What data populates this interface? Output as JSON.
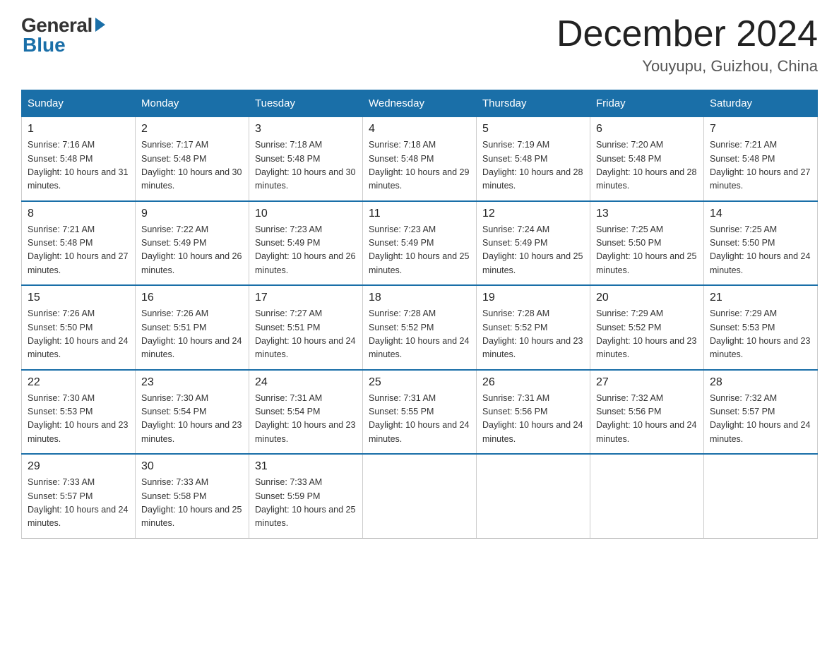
{
  "logo": {
    "general": "General",
    "blue": "Blue"
  },
  "title": "December 2024",
  "subtitle": "Youyupu, Guizhou, China",
  "days_of_week": [
    "Sunday",
    "Monday",
    "Tuesday",
    "Wednesday",
    "Thursday",
    "Friday",
    "Saturday"
  ],
  "weeks": [
    [
      {
        "day": "1",
        "sunrise": "7:16 AM",
        "sunset": "5:48 PM",
        "daylight": "10 hours and 31 minutes."
      },
      {
        "day": "2",
        "sunrise": "7:17 AM",
        "sunset": "5:48 PM",
        "daylight": "10 hours and 30 minutes."
      },
      {
        "day": "3",
        "sunrise": "7:18 AM",
        "sunset": "5:48 PM",
        "daylight": "10 hours and 30 minutes."
      },
      {
        "day": "4",
        "sunrise": "7:18 AM",
        "sunset": "5:48 PM",
        "daylight": "10 hours and 29 minutes."
      },
      {
        "day": "5",
        "sunrise": "7:19 AM",
        "sunset": "5:48 PM",
        "daylight": "10 hours and 28 minutes."
      },
      {
        "day": "6",
        "sunrise": "7:20 AM",
        "sunset": "5:48 PM",
        "daylight": "10 hours and 28 minutes."
      },
      {
        "day": "7",
        "sunrise": "7:21 AM",
        "sunset": "5:48 PM",
        "daylight": "10 hours and 27 minutes."
      }
    ],
    [
      {
        "day": "8",
        "sunrise": "7:21 AM",
        "sunset": "5:48 PM",
        "daylight": "10 hours and 27 minutes."
      },
      {
        "day": "9",
        "sunrise": "7:22 AM",
        "sunset": "5:49 PM",
        "daylight": "10 hours and 26 minutes."
      },
      {
        "day": "10",
        "sunrise": "7:23 AM",
        "sunset": "5:49 PM",
        "daylight": "10 hours and 26 minutes."
      },
      {
        "day": "11",
        "sunrise": "7:23 AM",
        "sunset": "5:49 PM",
        "daylight": "10 hours and 25 minutes."
      },
      {
        "day": "12",
        "sunrise": "7:24 AM",
        "sunset": "5:49 PM",
        "daylight": "10 hours and 25 minutes."
      },
      {
        "day": "13",
        "sunrise": "7:25 AM",
        "sunset": "5:50 PM",
        "daylight": "10 hours and 25 minutes."
      },
      {
        "day": "14",
        "sunrise": "7:25 AM",
        "sunset": "5:50 PM",
        "daylight": "10 hours and 24 minutes."
      }
    ],
    [
      {
        "day": "15",
        "sunrise": "7:26 AM",
        "sunset": "5:50 PM",
        "daylight": "10 hours and 24 minutes."
      },
      {
        "day": "16",
        "sunrise": "7:26 AM",
        "sunset": "5:51 PM",
        "daylight": "10 hours and 24 minutes."
      },
      {
        "day": "17",
        "sunrise": "7:27 AM",
        "sunset": "5:51 PM",
        "daylight": "10 hours and 24 minutes."
      },
      {
        "day": "18",
        "sunrise": "7:28 AM",
        "sunset": "5:52 PM",
        "daylight": "10 hours and 24 minutes."
      },
      {
        "day": "19",
        "sunrise": "7:28 AM",
        "sunset": "5:52 PM",
        "daylight": "10 hours and 23 minutes."
      },
      {
        "day": "20",
        "sunrise": "7:29 AM",
        "sunset": "5:52 PM",
        "daylight": "10 hours and 23 minutes."
      },
      {
        "day": "21",
        "sunrise": "7:29 AM",
        "sunset": "5:53 PM",
        "daylight": "10 hours and 23 minutes."
      }
    ],
    [
      {
        "day": "22",
        "sunrise": "7:30 AM",
        "sunset": "5:53 PM",
        "daylight": "10 hours and 23 minutes."
      },
      {
        "day": "23",
        "sunrise": "7:30 AM",
        "sunset": "5:54 PM",
        "daylight": "10 hours and 23 minutes."
      },
      {
        "day": "24",
        "sunrise": "7:31 AM",
        "sunset": "5:54 PM",
        "daylight": "10 hours and 23 minutes."
      },
      {
        "day": "25",
        "sunrise": "7:31 AM",
        "sunset": "5:55 PM",
        "daylight": "10 hours and 24 minutes."
      },
      {
        "day": "26",
        "sunrise": "7:31 AM",
        "sunset": "5:56 PM",
        "daylight": "10 hours and 24 minutes."
      },
      {
        "day": "27",
        "sunrise": "7:32 AM",
        "sunset": "5:56 PM",
        "daylight": "10 hours and 24 minutes."
      },
      {
        "day": "28",
        "sunrise": "7:32 AM",
        "sunset": "5:57 PM",
        "daylight": "10 hours and 24 minutes."
      }
    ],
    [
      {
        "day": "29",
        "sunrise": "7:33 AM",
        "sunset": "5:57 PM",
        "daylight": "10 hours and 24 minutes."
      },
      {
        "day": "30",
        "sunrise": "7:33 AM",
        "sunset": "5:58 PM",
        "daylight": "10 hours and 25 minutes."
      },
      {
        "day": "31",
        "sunrise": "7:33 AM",
        "sunset": "5:59 PM",
        "daylight": "10 hours and 25 minutes."
      },
      null,
      null,
      null,
      null
    ]
  ]
}
